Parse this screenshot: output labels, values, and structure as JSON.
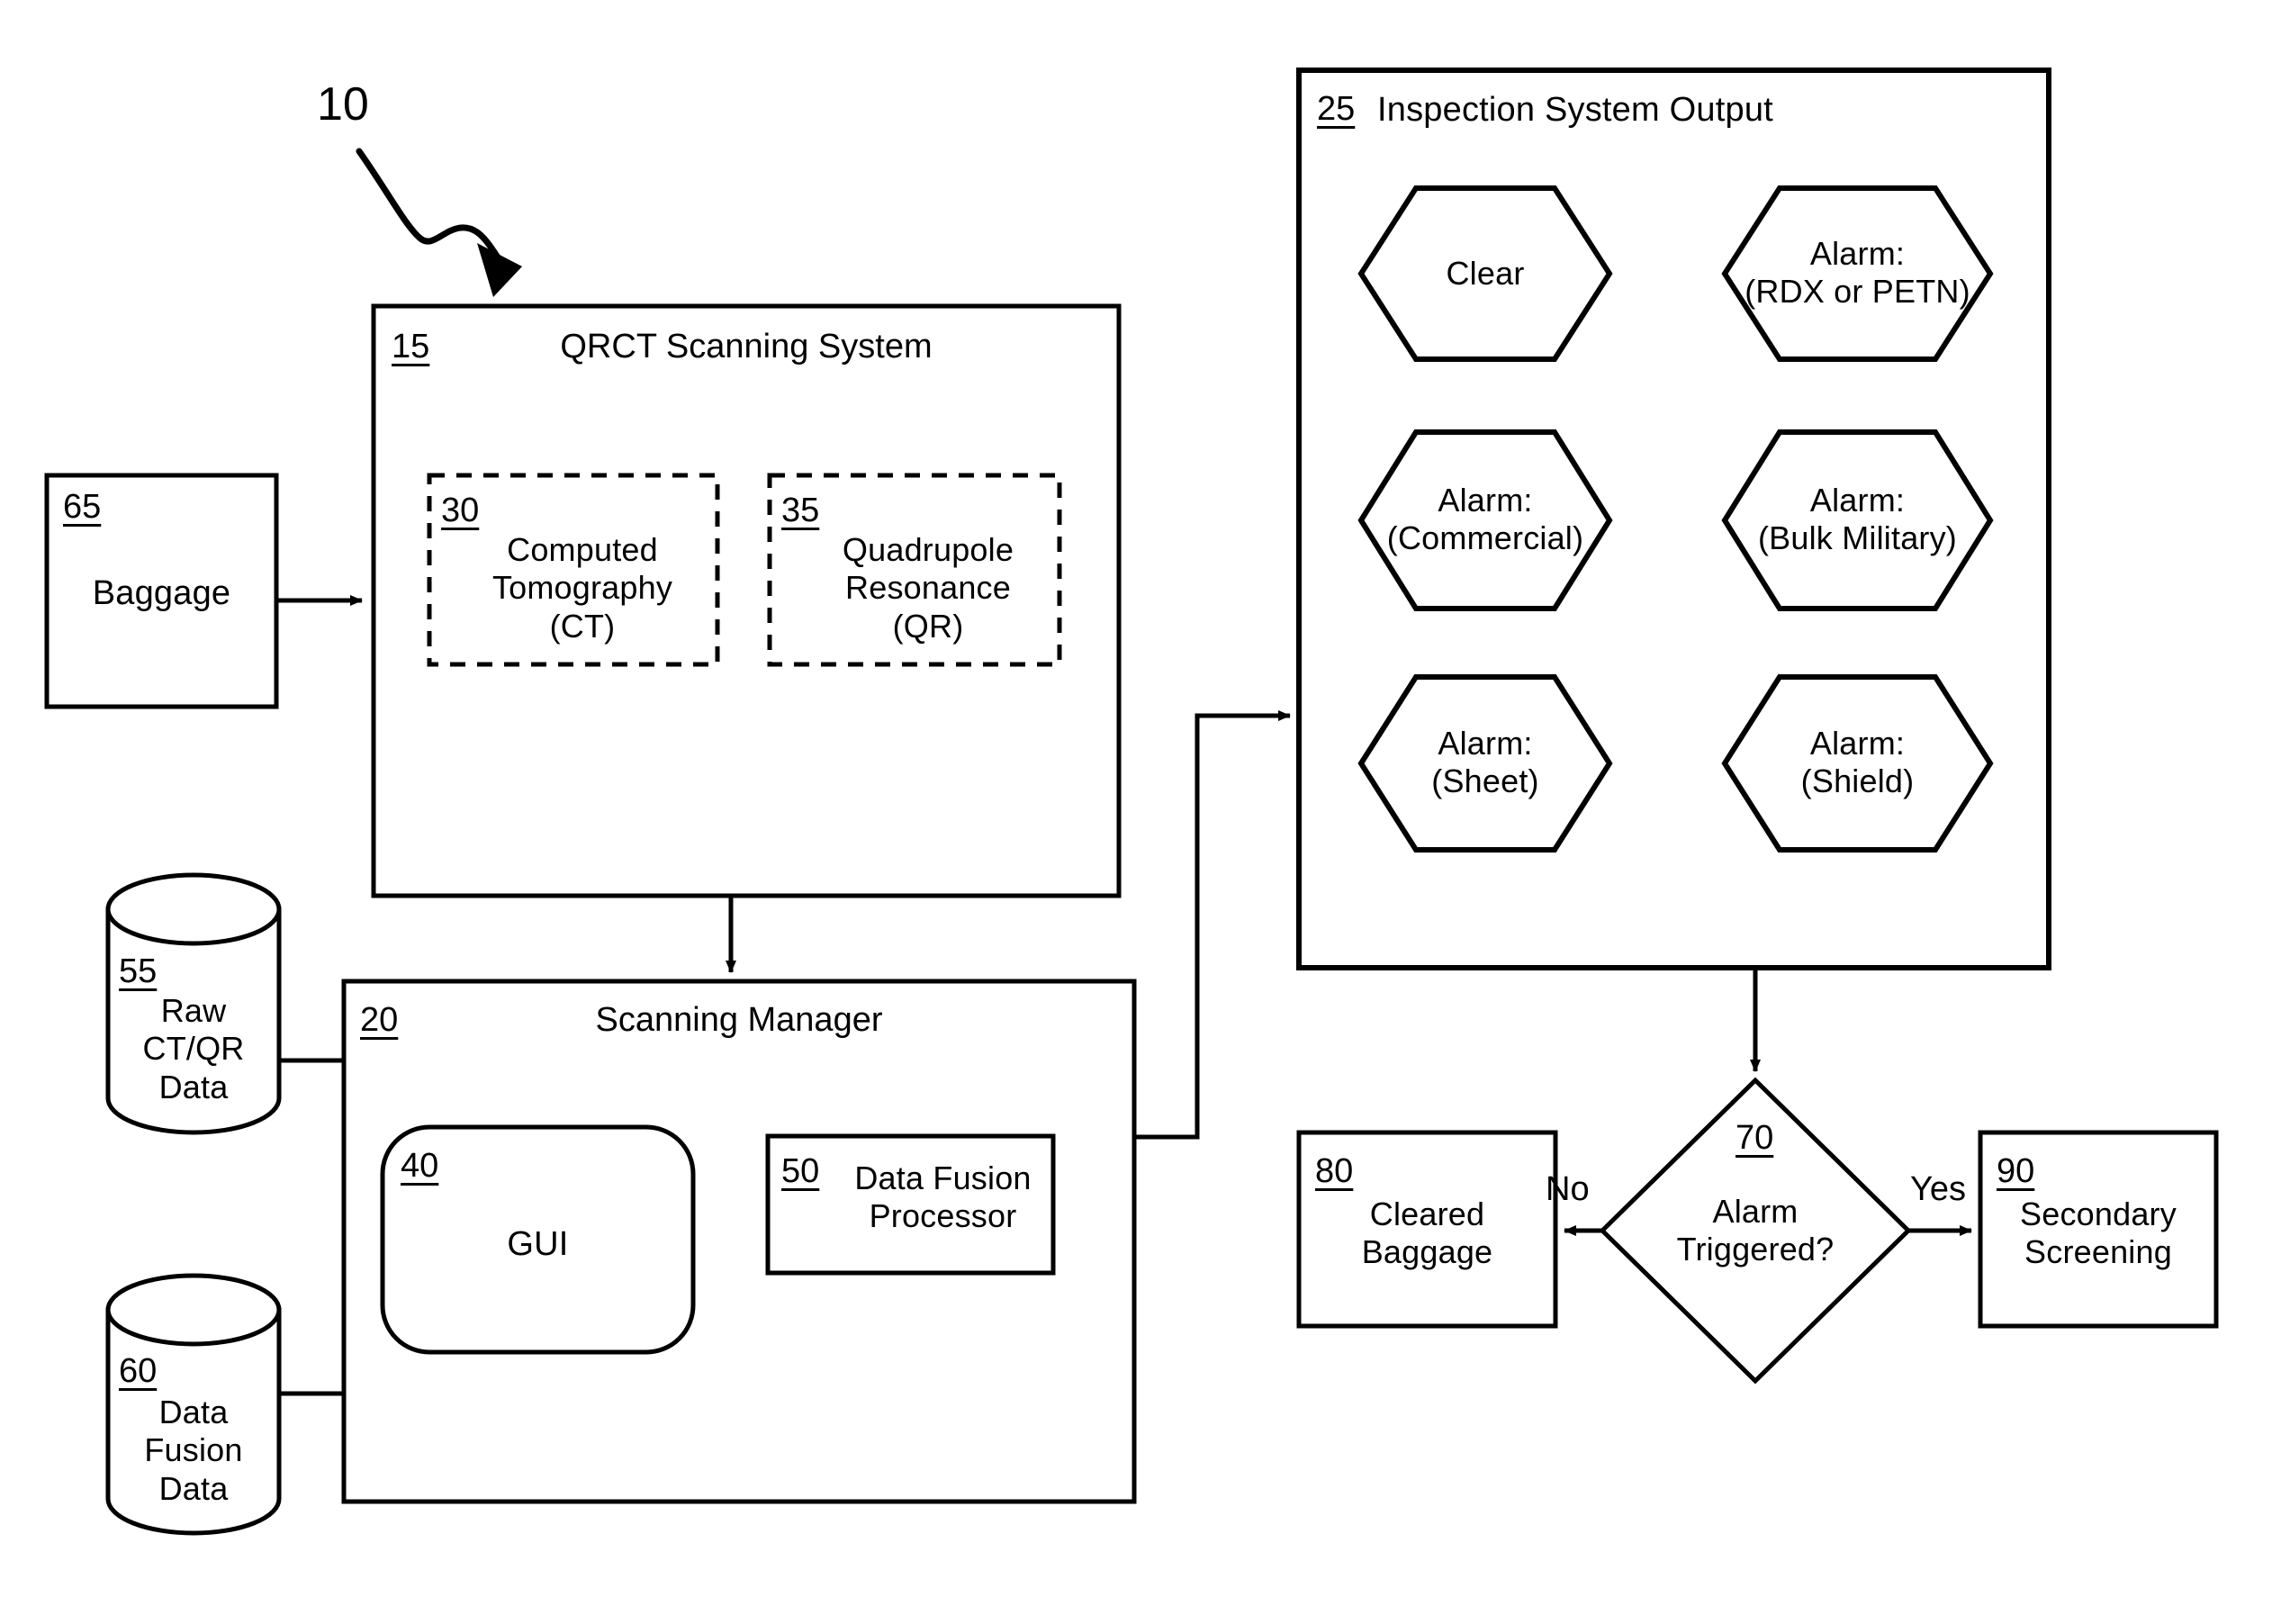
{
  "figure": {
    "figure_number": "10"
  },
  "nodes": {
    "baggage": {
      "ref": "65",
      "label": "Baggage"
    },
    "qrct_system": {
      "ref": "15",
      "title": "QRCT Scanning System",
      "children": [
        {
          "ref": "30",
          "label": "Computed\nTomography\n(CT)"
        },
        {
          "ref": "35",
          "label": "Quadrupole\nResonance\n(QR)"
        }
      ]
    },
    "scanning_manager": {
      "ref": "20",
      "title": "Scanning Manager",
      "children": [
        {
          "ref": "40",
          "label": "GUI"
        },
        {
          "ref": "50",
          "label": "Data Fusion\nProcessor"
        }
      ]
    },
    "raw_data_store": {
      "ref": "55",
      "label": "Raw\nCT/QR\nData"
    },
    "fusion_data_store": {
      "ref": "60",
      "label": "Data\nFusion\nData"
    },
    "inspection_output": {
      "ref": "25",
      "title": "Inspection System Output",
      "outcomes": [
        {
          "label": "Clear"
        },
        {
          "label": "Alarm:\n(RDX or PETN)"
        },
        {
          "label": "Alarm:\n(Commercial)"
        },
        {
          "label": "Alarm:\n(Bulk Military)"
        },
        {
          "label": "Alarm:\n(Sheet)"
        },
        {
          "label": "Alarm:\n(Shield)"
        }
      ]
    },
    "decision": {
      "ref": "70",
      "label": "Alarm\nTriggered?"
    },
    "cleared_baggage": {
      "ref": "80",
      "label": "Cleared\nBaggage"
    },
    "secondary_screening": {
      "ref": "90",
      "label": "Secondary\nScreening"
    }
  },
  "edges": {
    "decision_no": "No",
    "decision_yes": "Yes"
  },
  "colors": {
    "stroke": "#000000",
    "background": "#ffffff"
  }
}
